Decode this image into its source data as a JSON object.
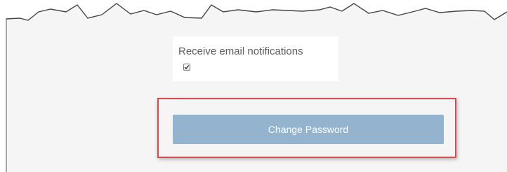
{
  "notifications": {
    "label": "Receive email notifications",
    "checked": true
  },
  "actions": {
    "change_password_label": "Change Password"
  },
  "colors": {
    "page_background": "#f5f5f5",
    "card_background": "#ffffff",
    "button_background": "#93b3cf",
    "button_text": "#ffffff",
    "highlight_border": "#d94a4f",
    "label_text": "#5b5b5b"
  }
}
